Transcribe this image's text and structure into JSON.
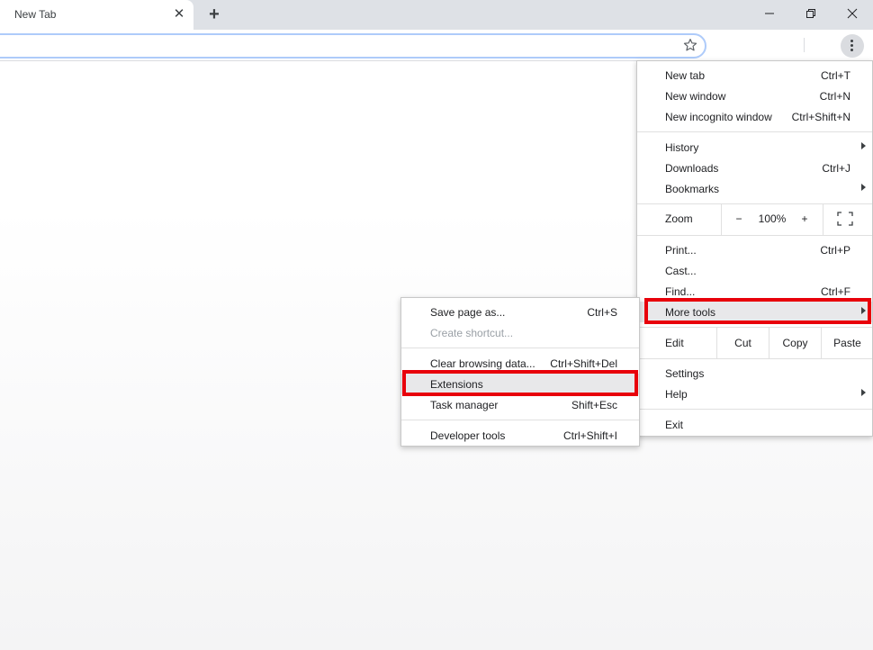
{
  "tab": {
    "title": "New Tab",
    "close": "✕",
    "new_tab": "+"
  },
  "window_controls": [
    "minimize-icon",
    "restore-icon",
    "close-icon"
  ],
  "toolbar": {
    "bookmark_icon": "star-icon",
    "menu_icon": "kebab-menu-icon"
  },
  "main_menu": {
    "new_tab": {
      "label": "New tab",
      "shortcut": "Ctrl+T"
    },
    "new_window": {
      "label": "New window",
      "shortcut": "Ctrl+N"
    },
    "new_incognito": {
      "label": "New incognito window",
      "shortcut": "Ctrl+Shift+N"
    },
    "history": {
      "label": "History"
    },
    "downloads": {
      "label": "Downloads",
      "shortcut": "Ctrl+J"
    },
    "bookmarks": {
      "label": "Bookmarks"
    },
    "zoom": {
      "label": "Zoom",
      "minus": "−",
      "value": "100%",
      "plus": "+"
    },
    "print": {
      "label": "Print...",
      "shortcut": "Ctrl+P"
    },
    "cast": {
      "label": "Cast..."
    },
    "find": {
      "label": "Find...",
      "shortcut": "Ctrl+F"
    },
    "more_tools": {
      "label": "More tools"
    },
    "edit": {
      "label": "Edit",
      "cut": "Cut",
      "copy": "Copy",
      "paste": "Paste"
    },
    "settings": {
      "label": "Settings"
    },
    "help": {
      "label": "Help"
    },
    "exit": {
      "label": "Exit"
    }
  },
  "sub_menu": {
    "save_page": {
      "label": "Save page as...",
      "shortcut": "Ctrl+S"
    },
    "create_shortcut": {
      "label": "Create shortcut..."
    },
    "clear_data": {
      "label": "Clear browsing data...",
      "shortcut": "Ctrl+Shift+Del"
    },
    "extensions": {
      "label": "Extensions"
    },
    "task_manager": {
      "label": "Task manager",
      "shortcut": "Shift+Esc"
    },
    "developer_tools": {
      "label": "Developer tools",
      "shortcut": "Ctrl+Shift+I"
    }
  },
  "colors": {
    "highlight_box": "#e8000b",
    "tabstrip": "#dee1e6"
  }
}
